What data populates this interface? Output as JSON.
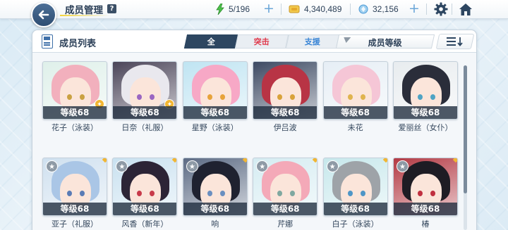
{
  "header": {
    "title": "成员管理",
    "help_label": "?",
    "resources": {
      "ap": "5/196",
      "credits": "4,340,489",
      "pyroxene": "32,156"
    },
    "plus_label": "+"
  },
  "panel": {
    "title": "成员列表",
    "tabs": [
      {
        "label": "全",
        "active": true
      },
      {
        "label": "突击",
        "active": false
      },
      {
        "label": "支援",
        "active": false
      }
    ],
    "sort_label": "成员等级"
  },
  "members": [
    {
      "name": "花子（泳装）",
      "level": "等级68",
      "support": true,
      "hair": "#f2b0bd",
      "bg": "#dff0ea",
      "eye": "#caa142",
      "starred": false
    },
    {
      "name": "日奈（礼服）",
      "level": "等级68",
      "support": true,
      "hair": "#e9e8ee",
      "bg": "#4a4458",
      "eye": "#9a66c2",
      "starred": false
    },
    {
      "name": "星野（泳装）",
      "level": "等级68",
      "support": false,
      "hair": "#f7a8c6",
      "bg": "#bfe4f2",
      "eye": "#e7a33b",
      "starred": false
    },
    {
      "name": "伊吕波",
      "level": "等级68",
      "support": false,
      "hair": "#b83445",
      "bg": "#3d4a63",
      "eye": "#d9a23a",
      "starred": false
    },
    {
      "name": "未花",
      "level": "等级68",
      "support": false,
      "hair": "#f5c6d6",
      "bg": "#e6eef5",
      "eye": "#e0b44e",
      "starred": false
    },
    {
      "name": "爱丽丝（女仆）",
      "level": "等级68",
      "support": false,
      "hair": "#2a2d3a",
      "bg": "#e8ecef",
      "eye": "#4fa3c4",
      "starred": false
    },
    {
      "name": "亚子（礼服）",
      "level": "等级68",
      "support": false,
      "hair": "#aac6e6",
      "bg": "#cfe0ef",
      "eye": "#5a7bb5",
      "starred": true
    },
    {
      "name": "风香（新年）",
      "level": "等级68",
      "support": false,
      "hair": "#2c2436",
      "bg": "#c9e1f0",
      "eye": "#c83a4a",
      "starred": true
    },
    {
      "name": "响",
      "level": "等级68",
      "support": false,
      "hair": "#1f2230",
      "bg": "#5c6b84",
      "eye": "#6a8fc0",
      "starred": true
    },
    {
      "name": "芹娜",
      "level": "等级68",
      "support": false,
      "hair": "#f4a9b8",
      "bg": "#d5ecf2",
      "eye": "#7fa8a0",
      "starred": true
    },
    {
      "name": "白子（泳装）",
      "level": "等级68",
      "support": false,
      "hair": "#9ea3a8",
      "bg": "#c7e8ec",
      "eye": "#4f96c7",
      "starred": true
    },
    {
      "name": "椿",
      "level": "等级68",
      "support": false,
      "hair": "#1e1c24",
      "bg": "#b33a44",
      "eye": "#c03040",
      "starred": true
    }
  ],
  "colors": {
    "accent_dark": "#2d4661",
    "strike": "#e0394b",
    "support": "#3b86d6",
    "gold": "#f2b632"
  },
  "icons": {
    "back": "back-arrow-icon",
    "ap": "lightning-icon",
    "credits": "credit-coin-icon",
    "pyroxene": "pyroxene-gem-icon",
    "settings": "gear-icon",
    "home": "home-icon",
    "sort_order": "sort-descending-icon",
    "filter": "filter-icon"
  }
}
